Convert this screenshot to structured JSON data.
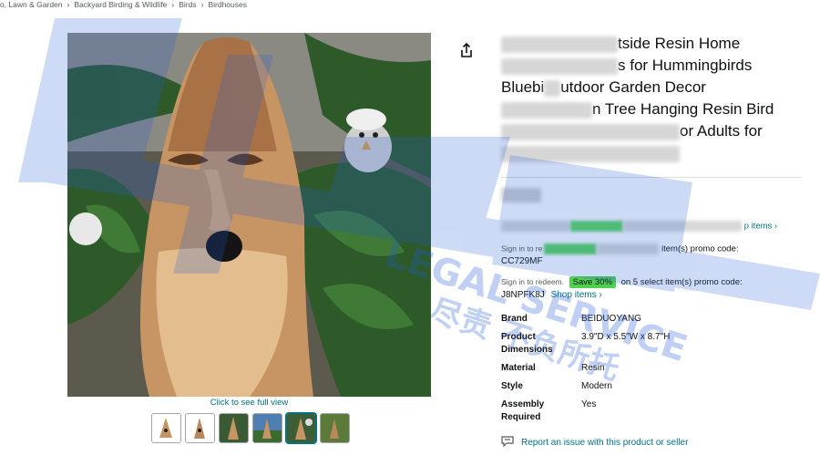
{
  "breadcrumb": {
    "items": [
      "o, Lawn & Garden",
      "Backyard Birding & Wildlife",
      "Birds",
      "Birdhouses"
    ],
    "separator": "›"
  },
  "gallery": {
    "full_view_label": "Click to see full view",
    "thumbnail_count": 6,
    "selected_index": 4
  },
  "product": {
    "title_lines": [
      "tside Resin Home",
      "s for Hummingbirds",
      "Bluebi",
      "utdoor Garden Decor",
      "n Tree Hanging Resin Bird",
      "or Adults for"
    ],
    "coupons": [
      {
        "prefix": "Sign in to re",
        "suffix": "item(s) promo code:",
        "code": "CC729MF",
        "link": "p items ›"
      },
      {
        "prefix": "Sign in to redeem.",
        "badge": "Save 30%",
        "suffix": "on 5 select item(s) promo code:",
        "code": "J8NPFK8J",
        "link": "Shop items ›"
      }
    ],
    "specs": [
      {
        "label": "Brand",
        "value": "BEIDUOYANG"
      },
      {
        "label": "Product Dimensions",
        "value": "3.9\"D x 5.5\"W x 8.7\"H"
      },
      {
        "label": "Material",
        "value": "Resin"
      },
      {
        "label": "Style",
        "value": "Modern"
      },
      {
        "label": "Assembly Required",
        "value": "Yes"
      }
    ],
    "report_link": "Report an issue with this product or seller"
  },
  "watermark": {
    "latin": "LEGAL SERVICE",
    "cjk_line": "尽责 不负所托"
  },
  "colors": {
    "link": "#007185",
    "badge": "#52d150",
    "watermark": "#1f5bd8"
  }
}
